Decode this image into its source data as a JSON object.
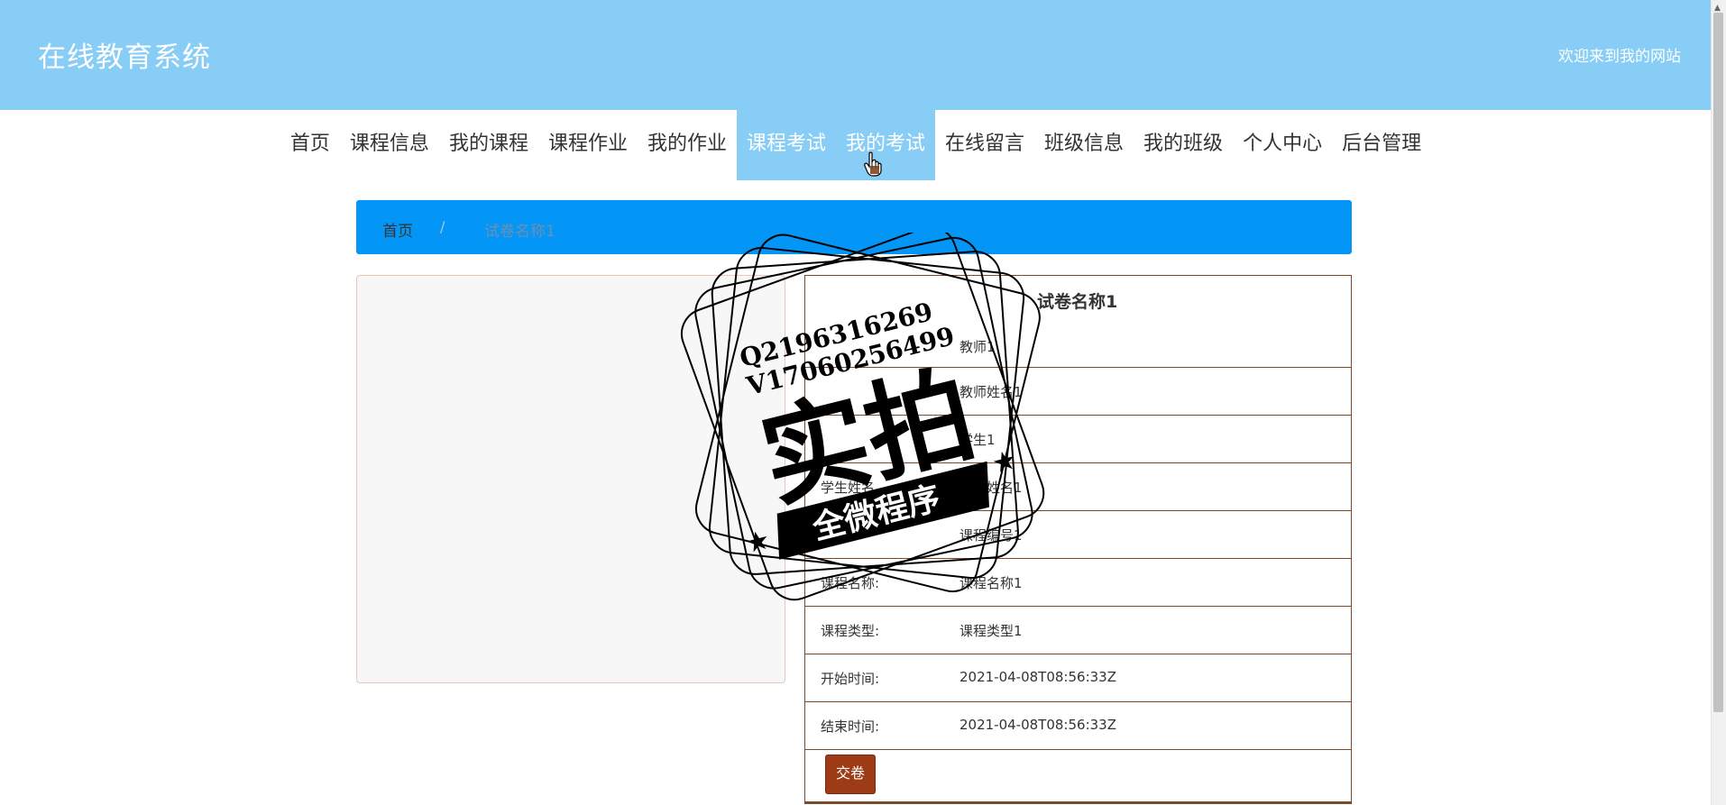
{
  "header": {
    "site_title": "在线教育系统",
    "welcome": "欢迎来到我的网站"
  },
  "nav": {
    "items": [
      {
        "label": "首页",
        "active": false
      },
      {
        "label": "课程信息",
        "active": false
      },
      {
        "label": "我的课程",
        "active": false
      },
      {
        "label": "课程作业",
        "active": false
      },
      {
        "label": "我的作业",
        "active": false
      },
      {
        "label": "课程考试",
        "active": true
      },
      {
        "label": "我的考试",
        "active": true
      },
      {
        "label": "在线留言",
        "active": false
      },
      {
        "label": "班级信息",
        "active": false
      },
      {
        "label": "我的班级",
        "active": false
      },
      {
        "label": "个人中心",
        "active": false
      },
      {
        "label": "后台管理",
        "active": false
      }
    ]
  },
  "breadcrumb": {
    "home": "首页",
    "separator": "/",
    "current": "试卷名称1"
  },
  "detail": {
    "title": "试卷名称1",
    "rows": [
      {
        "label": "",
        "value": "教师1"
      },
      {
        "label": "",
        "value": "教师姓名1"
      },
      {
        "label": "",
        "value": "学生1"
      },
      {
        "label": "学生姓名",
        "value": "学生姓名1"
      },
      {
        "label": "",
        "value": "课程编号1"
      },
      {
        "label": "课程名称:",
        "value": "课程名称1"
      },
      {
        "label": "课程类型:",
        "value": "课程类型1"
      },
      {
        "label": "开始时间:",
        "value": "2021-04-08T08:56:33Z"
      },
      {
        "label": "结束时间:",
        "value": "2021-04-08T08:56:33Z"
      }
    ],
    "submit_label": "交卷"
  },
  "watermark": {
    "line1": "Q2196316269",
    "line2": "V17060256499",
    "main": "实拍",
    "banner": "全微程序"
  },
  "icons": {
    "cursor": "hand-pointer-icon"
  },
  "colors": {
    "header_bg": "#87cdf6",
    "breadcrumb_bg": "#0396f6",
    "submit_bg": "#9d3b16",
    "border": "#7a4a2a"
  }
}
